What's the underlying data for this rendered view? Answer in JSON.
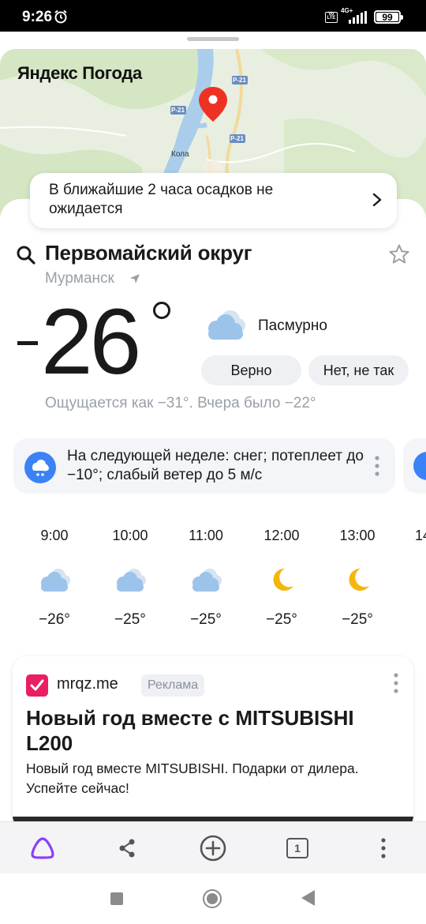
{
  "status_bar": {
    "time": "9:26",
    "volte": "Vo LTE",
    "network": "4G+",
    "battery": "99"
  },
  "map": {
    "title": "Яндекс Погода",
    "road_labels": [
      "Р-21",
      "Р-21",
      "Р-21"
    ],
    "place_label": "Кола"
  },
  "precipitation": {
    "text": "В ближайшие 2 часа осадков не ожидается"
  },
  "location": {
    "district": "Первомайский округ",
    "city": "Мурманск"
  },
  "current": {
    "sign": "−",
    "temperature": "26",
    "condition": "Пасмурно",
    "feedback_yes": "Верно",
    "feedback_no": "Нет, не так",
    "feels_like": "Ощущается как −31°. Вчера было −22°"
  },
  "weekly_forecast": {
    "text": "На следующей неделе: снег; потеплеет до −10°; слабый ветер до 5 м/с"
  },
  "hourly": [
    {
      "time": "9:00",
      "icon": "cloudy-icon",
      "temp": "−26°"
    },
    {
      "time": "10:00",
      "icon": "cloudy-icon",
      "temp": "−25°"
    },
    {
      "time": "11:00",
      "icon": "cloudy-icon",
      "temp": "−25°"
    },
    {
      "time": "12:00",
      "icon": "moon-icon",
      "temp": "−25°"
    },
    {
      "time": "13:00",
      "icon": "moon-icon",
      "temp": "−25°"
    },
    {
      "time": "14",
      "icon": "moon-icon",
      "temp": ""
    }
  ],
  "ad": {
    "domain": "mrqz.me",
    "badge": "Реклама",
    "title": "Новый год вместе с MITSUBISHI L200",
    "description": "Новый год вместе MITSUBISHI. Подарки от дилера. Успейте сейчас!"
  },
  "toolbar": {
    "tabs_count": "1",
    "items": [
      "alice-icon",
      "share-icon",
      "add-icon",
      "tabs-icon",
      "more-icon"
    ]
  },
  "colors": {
    "accent_blue": "#3b82f6",
    "pin_red": "#ef3124",
    "alice_purple": "#8a3ffc",
    "muted_text": "#9aa0a8",
    "card_bg": "#f3f5f8"
  }
}
